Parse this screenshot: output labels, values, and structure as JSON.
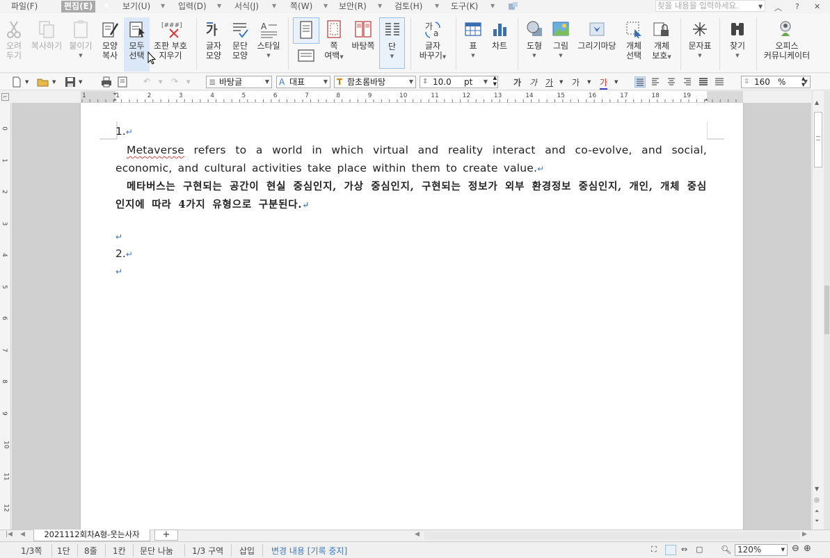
{
  "menu": {
    "items": [
      {
        "label": "파일(F)"
      },
      {
        "label": "편집(E)"
      },
      {
        "label": "보기(U)"
      },
      {
        "label": "입력(D)"
      },
      {
        "label": "서식(J)"
      },
      {
        "label": "쪽(W)"
      },
      {
        "label": "보안(R)"
      },
      {
        "label": "검토(H)"
      },
      {
        "label": "도구(K)"
      }
    ],
    "active_item": "편집(E)",
    "search_placeholder": "찾을 내용을 입력하세요."
  },
  "ribbon": {
    "cut": [
      "오려",
      "두기"
    ],
    "copy": "복사하기",
    "paste": "붙이기",
    "format_copy": [
      "모양",
      "복사"
    ],
    "select_all": [
      "모두",
      "선택"
    ],
    "remove_codes": [
      "조판 부호",
      "지우기"
    ],
    "char_shape": [
      "글자",
      "모양"
    ],
    "para_shape": [
      "문단",
      "모양"
    ],
    "style": "스타일",
    "page_margin": [
      "쪽",
      "여백"
    ],
    "background_page": "바탕쪽",
    "columns": "단",
    "replace_char": [
      "글자",
      "바꾸기"
    ],
    "table": "표",
    "chart": "차트",
    "shape": "도형",
    "picture": "그림",
    "drawing_gallery": "그리기마당",
    "object_select": [
      "개체",
      "선택"
    ],
    "object_protect": [
      "개체",
      "보호"
    ],
    "char_map": "문자표",
    "find": "찾기",
    "office_communicator": [
      "오피스",
      "커뮤니케이터"
    ]
  },
  "toolbar": {
    "style_combo": "바탕글",
    "lang_combo": "대표",
    "font_combo": "함초롬바탕",
    "font_size": "10.0",
    "size_unit": "pt",
    "zoom_value": "160",
    "zoom_unit": "%"
  },
  "ruler": {
    "numbers": [
      "1",
      "1",
      "2",
      "3",
      "4",
      "5",
      "6",
      "7",
      "8",
      "9",
      "10",
      "11",
      "12",
      "13",
      "14",
      "15",
      "16",
      "17",
      "18",
      "19"
    ]
  },
  "vruler": {
    "numbers": [
      "0",
      "1",
      "2",
      "3",
      "4",
      "5",
      "6",
      "7",
      "8",
      "9",
      "10",
      "11",
      "12"
    ]
  },
  "document": {
    "item1": "1.",
    "en_para": "Metaverse refers to a world in which virtual and reality interact and co-evolve, and social, economic, and cultural activities take place within them to create value.",
    "en_first_word": "Metaverse",
    "ko_para": "메타버스는 구현되는 공간이 현실 중심인지, 가상 중심인지, 구현되는 정보가 외부 환경정보 중심인지, 개인, 개체 중심인지에 따라 4가지 유형으로 구분된다.",
    "item2": "2.",
    "para_mark": "↵"
  },
  "tabs": {
    "doc_tab": "2021112회차A형-웃는사자",
    "add": "+"
  },
  "status": {
    "page": "1/3쪽",
    "column": "1단",
    "line": "8줄",
    "col": "1칸",
    "para_break": "문단 나눔",
    "section": "1/3 구역",
    "insert_mode": "삽입",
    "track_changes": "변경 내용 [기록 중지]",
    "zoom": "120%"
  },
  "colors": {
    "accent": "#3a78c2",
    "menu_active_bg": "#a9a9a9",
    "selected_bg": "#dbe8f7"
  }
}
